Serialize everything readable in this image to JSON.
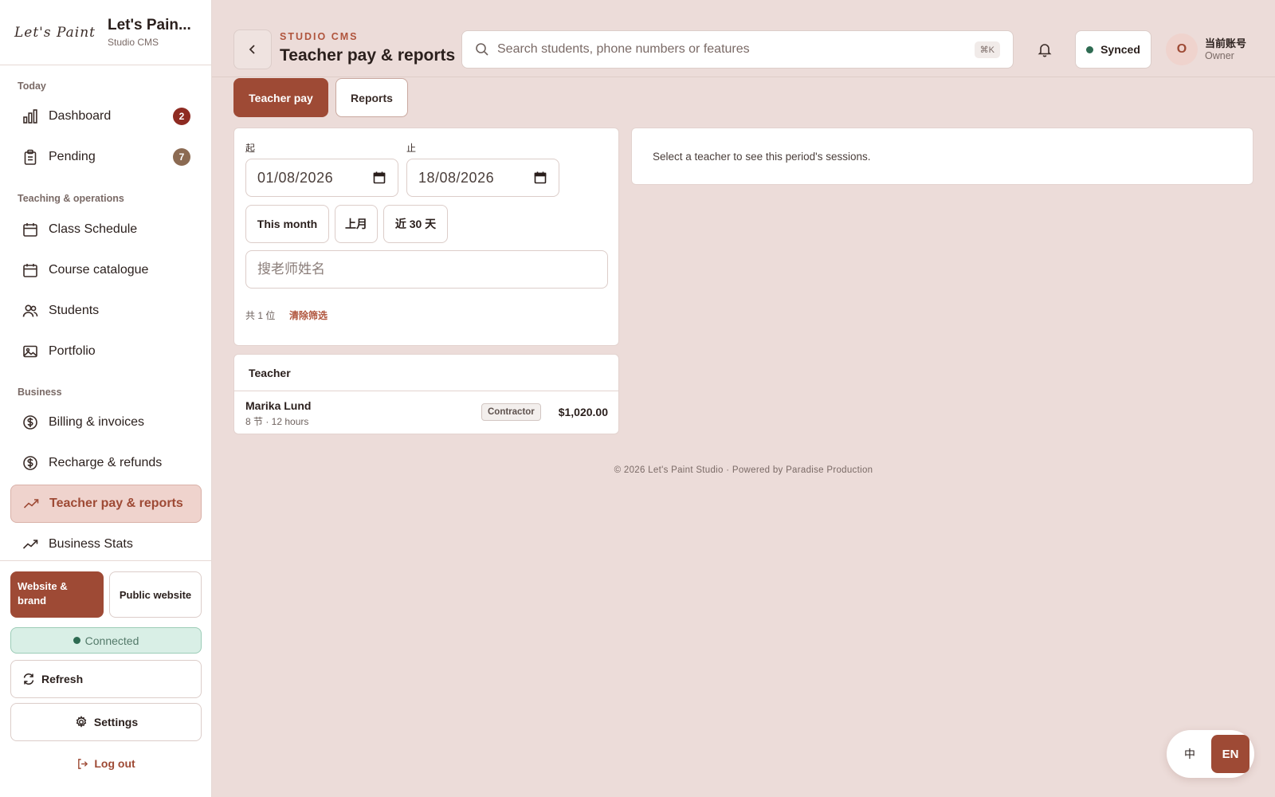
{
  "brand": {
    "logo": "Let's Paint",
    "name": "Let's Pain...",
    "subtitle": "Studio CMS"
  },
  "sidebar": {
    "sections": [
      "Today",
      "Teaching & operations",
      "Business"
    ],
    "items": [
      {
        "label": "Dashboard",
        "icon": "bar-chart-icon",
        "badge": "2",
        "badge_color": "#8e2b22"
      },
      {
        "label": "Pending",
        "icon": "clipboard-icon",
        "badge": "7",
        "badge_color": "#8b6a52"
      },
      {
        "label": "Class Schedule",
        "icon": "calendar-icon"
      },
      {
        "label": "Course catalogue",
        "icon": "calendar-icon"
      },
      {
        "label": "Students",
        "icon": "users-icon"
      },
      {
        "label": "Portfolio",
        "icon": "image-icon"
      },
      {
        "label": "Billing & invoices",
        "icon": "dollar-circle-icon"
      },
      {
        "label": "Recharge & refunds",
        "icon": "dollar-circle-icon"
      },
      {
        "label": "Teacher pay & reports",
        "icon": "trend-line-icon",
        "active": true
      },
      {
        "label": "Business Stats",
        "icon": "trend-line-icon"
      }
    ],
    "website_button": "Website & brand",
    "public_button": "Public website",
    "connection_status": "Connected",
    "refresh_label": "Refresh",
    "settings_label": "Settings",
    "logout_label": "Log out"
  },
  "header": {
    "kicker": "STUDIO CMS",
    "title": "Teacher pay & reports",
    "search_placeholder": "Search students, phone numbers or features",
    "search_shortcut": "⌘K",
    "sync_status": "Synced",
    "avatar_initial": "O",
    "account_name": "当前账号",
    "account_role": "Owner"
  },
  "tabs": [
    {
      "label": "Teacher pay",
      "active": true
    },
    {
      "label": "Reports",
      "active": false
    }
  ],
  "filters": {
    "from_label": "起",
    "to_label": "止",
    "from_date": "01/08/2026",
    "to_date": "18/08/2026",
    "quick_ranges": [
      "This month",
      "上月",
      "近 30 天"
    ],
    "teacher_search_placeholder": "搜老师姓名",
    "count_text": "共 1 位",
    "clear_label": "清除筛选"
  },
  "teacher_table": {
    "header": "Teacher",
    "rows": [
      {
        "name": "Marika Lund",
        "meta": "8 节 · 12 hours",
        "type": "Contractor",
        "amount": "$1,020.00"
      }
    ]
  },
  "sessions_panel": {
    "message": "Select a teacher to see this period's sessions."
  },
  "footer": "© 2026 Let's Paint Studio · Powered by Paradise Production",
  "language": {
    "zh": "中",
    "en": "EN",
    "selected": "EN"
  },
  "colors": {
    "accent": "#9e4a35",
    "background": "#ecdcd9",
    "success": "#2e6b52",
    "alert": "#8e2b22"
  }
}
